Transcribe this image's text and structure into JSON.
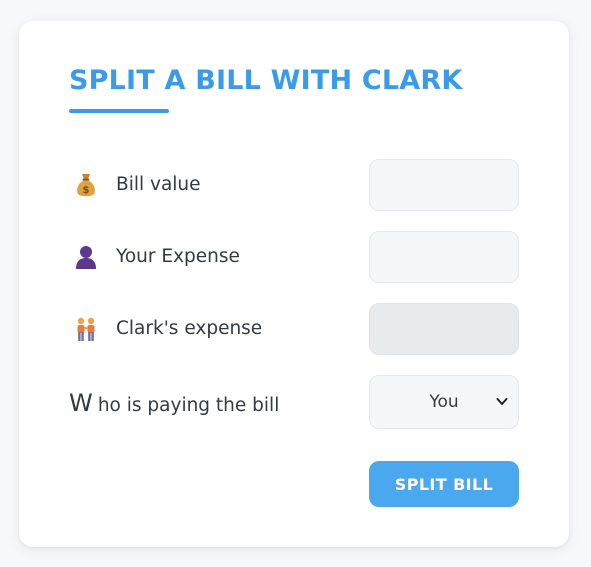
{
  "form": {
    "title": "SPLIT A BILL WITH CLARK",
    "bill_value": {
      "label": "Bill value",
      "icon": "money-bag-icon",
      "value": ""
    },
    "your_expense": {
      "label": "Your Expense",
      "icon": "person-silhouette-icon",
      "value": ""
    },
    "friend_expense": {
      "label": "Clark's expense",
      "icon": "two-people-icon",
      "value": ""
    },
    "payer": {
      "label_initial": "W",
      "label_rest": "ho is paying the bill",
      "selected": "You"
    },
    "submit_label": "SPLIT BILL"
  },
  "colors": {
    "accent": "#3a9be8",
    "button": "#4aa8ef",
    "input_bg": "#f6f7f9",
    "disabled_bg": "#e8ebee",
    "text": "#343a40"
  }
}
